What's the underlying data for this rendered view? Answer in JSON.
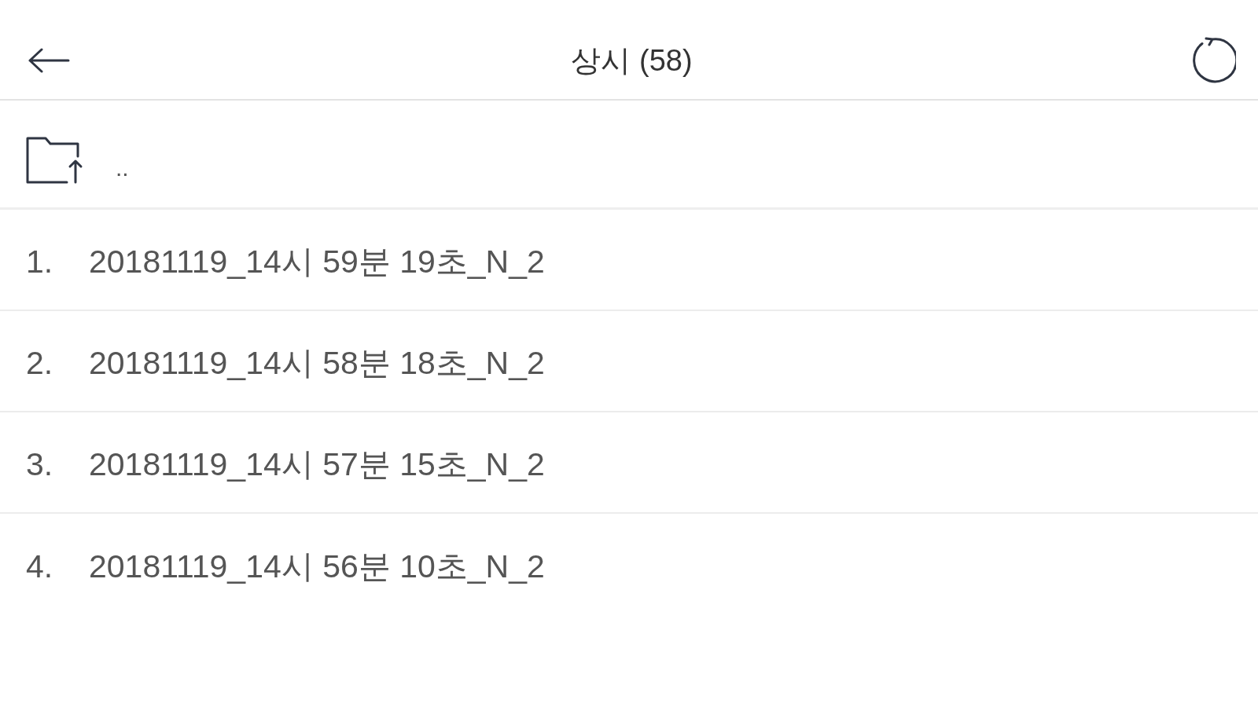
{
  "header": {
    "title": "상시 (58)"
  },
  "parent_row": {
    "label": ".."
  },
  "files": [
    {
      "number": "1.",
      "name": "20181119_14시 59분 19초_N_2"
    },
    {
      "number": "2.",
      "name": "20181119_14시 58분 18초_N_2"
    },
    {
      "number": "3.",
      "name": "20181119_14시 57분 15초_N_2"
    },
    {
      "number": "4.",
      "name": "20181119_14시 56분 10초_N_2"
    }
  ]
}
